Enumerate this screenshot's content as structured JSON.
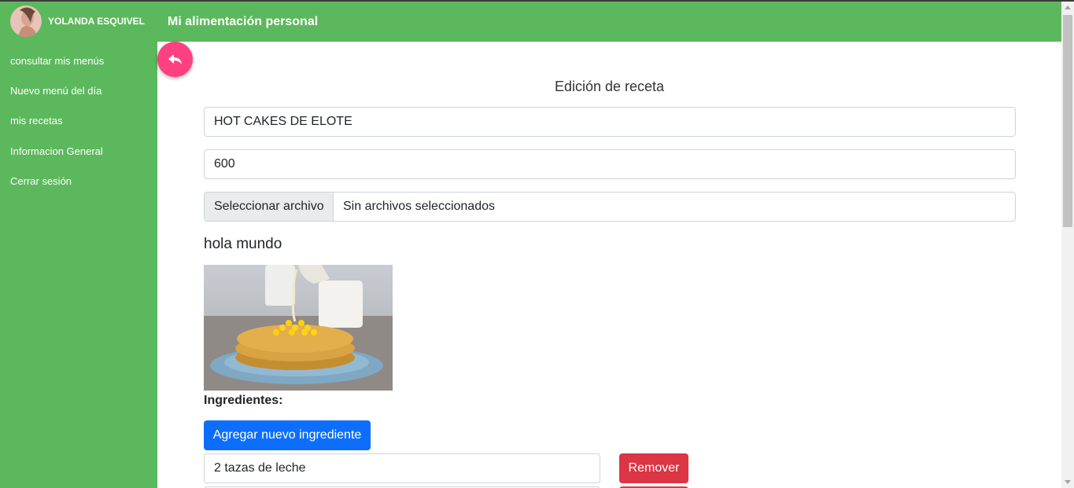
{
  "user": {
    "name": "YOLANDA ESQUIVEL"
  },
  "sidebar": {
    "items": [
      {
        "label": "consultar mis menús"
      },
      {
        "label": "Nuevo menú del día"
      },
      {
        "label": "mis recetas"
      },
      {
        "label": "Informacion General"
      },
      {
        "label": "Cerrar sesión"
      }
    ]
  },
  "header": {
    "title": "Mi alimentación personal"
  },
  "form": {
    "title": "Edición de receta",
    "recipe_name": "HOT CAKES DE ELOTE",
    "calories": "600",
    "file_button": "Seleccionar archivo",
    "file_status": "Sin archivos seleccionados",
    "description": "hola mundo",
    "ingredients_label": "Ingredientes:",
    "add_ingredient_label": "Agregar nuevo ingrediente",
    "ingredients": [
      {
        "value": "2 tazas de leche",
        "remove_label": "Remover"
      }
    ]
  },
  "colors": {
    "sidebar": "#5cb85c",
    "back_button": "#ff4081",
    "primary": "#0d6efd",
    "danger": "#dc3545"
  }
}
